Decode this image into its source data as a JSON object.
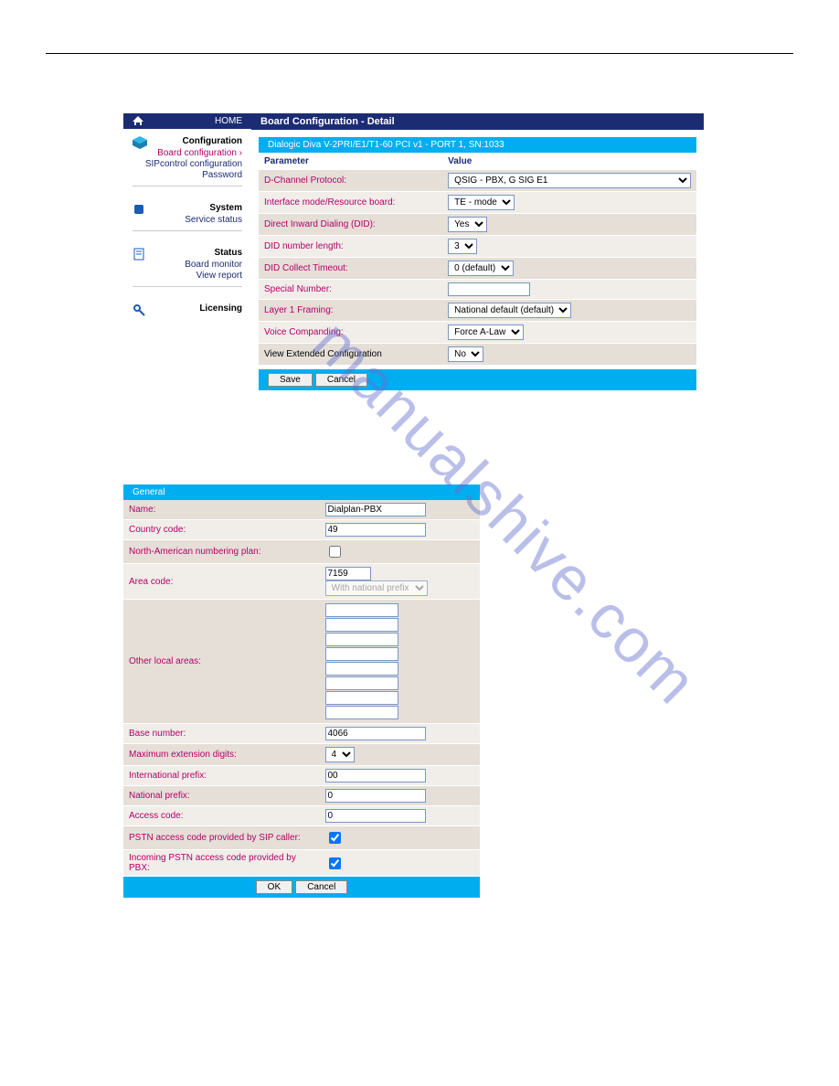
{
  "watermark": "manualshive.com",
  "home_label": "HOME",
  "sidebar": {
    "s1": {
      "head": "Configuration",
      "l1": "Board configuration ›",
      "l2": "SIPcontrol configuration",
      "l3": "Password"
    },
    "s2": {
      "head": "System",
      "l1": "Service status"
    },
    "s3": {
      "head": "Status",
      "l1": "Board monitor",
      "l2": "View report"
    },
    "s4": {
      "head": "Licensing"
    }
  },
  "title_bar": "Board Configuration - Detail",
  "sub_title": "Dialogic Diva V-2PRI/E1/T1-60 PCI v1 - PORT 1, SN:1033",
  "cfg_headers": {
    "param": "Parameter",
    "value": "Value"
  },
  "cfg": {
    "r1": {
      "p": "D-Channel Protocol:",
      "v": "QSIG - PBX, G SIG E1"
    },
    "r2": {
      "p": "Interface mode/Resource board:",
      "v": "TE - mode"
    },
    "r3": {
      "p": "Direct Inward Dialing (DID):",
      "v": "Yes"
    },
    "r4": {
      "p": "DID number length:",
      "v": "3"
    },
    "r5": {
      "p": "DID Collect Timeout:",
      "v": "0 (default)"
    },
    "r6": {
      "p": "Special Number:",
      "v": ""
    },
    "r7": {
      "p": "Layer 1 Framing:",
      "v": "National default (default)"
    },
    "r8": {
      "p": "Voice Companding:",
      "v": "Force A-Law"
    },
    "r9": {
      "p": "View Extended Configuration",
      "v": "No"
    }
  },
  "btn_save": "Save",
  "btn_cancel": "Cancel",
  "gen_header": "General",
  "gen": {
    "r1": {
      "p": "Name:",
      "v": "Dialplan-PBX"
    },
    "r2": {
      "p": "Country code:",
      "v": "49"
    },
    "r3": {
      "p": "North-American numbering plan:"
    },
    "r4": {
      "p": "Area code:",
      "v": "7159",
      "opt": "With national prefix"
    },
    "r5": {
      "p": "Other local areas:"
    },
    "r6": {
      "p": "Base number:",
      "v": "4066"
    },
    "r7": {
      "p": "Maximum extension digits:",
      "v": "4"
    },
    "r8": {
      "p": "International prefix:",
      "v": "00"
    },
    "r9": {
      "p": "National prefix:",
      "v": "0"
    },
    "r10": {
      "p": "Access code:",
      "v": "0"
    },
    "r11": {
      "p": "PSTN access code provided by SIP caller:"
    },
    "r12": {
      "p": "Incoming PSTN access code provided by PBX:"
    }
  },
  "btn_ok": "OK"
}
